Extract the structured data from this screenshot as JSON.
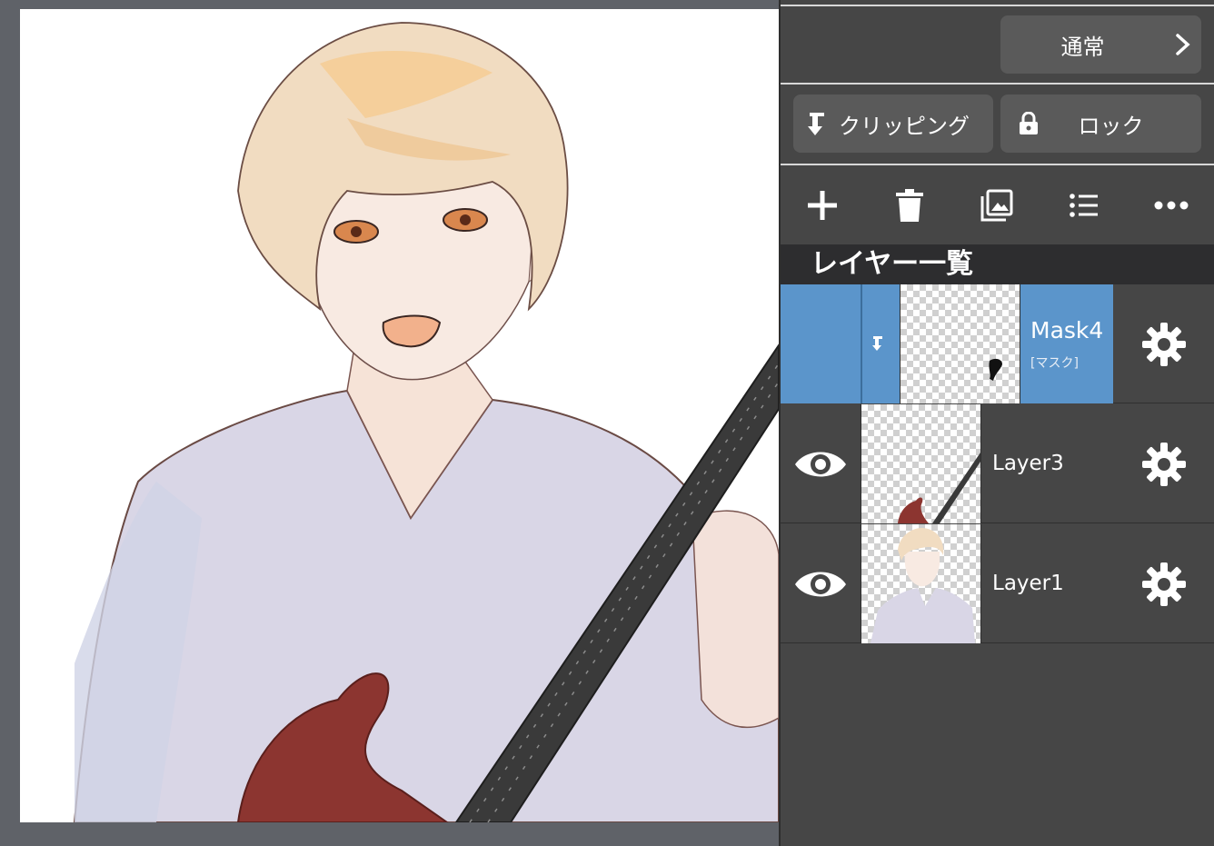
{
  "panel": {
    "blend_mode": "通常",
    "clipping_label": "クリッピング",
    "lock_label": "ロック",
    "layers_title": "レイヤー一覧",
    "toolbar": [
      "add-layer",
      "delete-layer",
      "import-image",
      "layer-menu-list",
      "more-options"
    ]
  },
  "layers": [
    {
      "name": "Mask4",
      "subtitle": "[マスク]",
      "selected": true,
      "clipped": true,
      "visible": true
    },
    {
      "name": "Layer3",
      "selected": false,
      "visible": true
    },
    {
      "name": "Layer1",
      "selected": false,
      "visible": true
    }
  ],
  "colors": {
    "selected_row": "#5b95cb",
    "panel_bg": "#464646",
    "button_bg": "#5a5a5a",
    "header_bg": "#2d2d2f",
    "canvas_bg": "#5f6268"
  }
}
